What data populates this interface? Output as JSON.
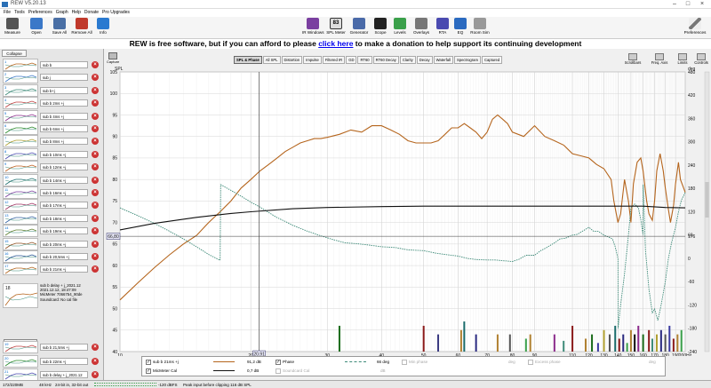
{
  "window": {
    "title": "REW V5.20.13"
  },
  "menu": [
    "File",
    "Tools",
    "Preferences",
    "Graph",
    "Help",
    "Donate",
    "Pro Upgrades"
  ],
  "toolbar_left": [
    {
      "label": "Measure",
      "icon": "microphone-icon",
      "color": "#555"
    },
    {
      "label": "Open",
      "icon": "folder-icon",
      "color": "#3a78c8"
    },
    {
      "label": "Save All",
      "icon": "save-icon",
      "color": "#4a6fa5"
    },
    {
      "label": "Remove All",
      "icon": "remove-icon",
      "color": "#c0392b"
    },
    {
      "label": "Info",
      "icon": "info-icon",
      "color": "#2a7ad0"
    }
  ],
  "toolbar_right": [
    {
      "label": "IR Windows",
      "icon": "ir-windows-icon",
      "color": "#7a3fa0"
    },
    {
      "label": "SPL Meter",
      "icon": "spl-meter-icon",
      "color": "#333"
    },
    {
      "label": "Generator",
      "icon": "generator-icon",
      "color": "#4a6aa8"
    },
    {
      "label": "Scope",
      "icon": "scope-icon",
      "color": "#222"
    },
    {
      "label": "Levels",
      "icon": "levels-icon",
      "color": "#3aa04a"
    },
    {
      "label": "Overlays",
      "icon": "overlays-icon",
      "color": "#777"
    },
    {
      "label": "RTA",
      "icon": "rta-icon",
      "color": "#4a4ab0"
    },
    {
      "label": "EQ",
      "icon": "eq-icon",
      "color": "#2a6ac0"
    },
    {
      "label": "Room Sim",
      "icon": "room-sim-icon",
      "color": "#999"
    }
  ],
  "spl_meter_value": "83",
  "preferences_label": "Preferences",
  "banner": {
    "prefix": "REW is free software, but if you can afford to please ",
    "link": "click here",
    "suffix": " to make a donation to help support its continuing development"
  },
  "left_panel": {
    "collapse_label": "Collapse",
    "measurements": [
      {
        "num": "1",
        "name": "sub b"
      },
      {
        "num": "2",
        "name": "sub j"
      },
      {
        "num": "3",
        "name": "sub b+j"
      },
      {
        "num": "4",
        "name": "sub b 2ms +j"
      },
      {
        "num": "5",
        "name": "sub b 4ms +j"
      },
      {
        "num": "6",
        "name": "sub b 6ms +j"
      },
      {
        "num": "7",
        "name": "sub b 8ms +j"
      },
      {
        "num": "8",
        "name": "sub b 10ms +j"
      },
      {
        "num": "9",
        "name": "sub b 12ms +j"
      },
      {
        "num": "10",
        "name": "sub b 14ms +j"
      },
      {
        "num": "11",
        "name": "sub b 16ms +j"
      },
      {
        "num": "12",
        "name": "sub b 17ms +j"
      },
      {
        "num": "13",
        "name": "sub b 18ms +j"
      },
      {
        "num": "14",
        "name": "sub b 19ms +j"
      },
      {
        "num": "15",
        "name": "sub b 20ms +j"
      },
      {
        "num": "16",
        "name": "sub b 20,5ms +j"
      },
      {
        "num": "17",
        "name": "sub b 21ms +j"
      }
    ],
    "selected": {
      "num": "18",
      "name": "sub b delay + j_2021.12",
      "date": "2021.12.12, 18:47:09",
      "mic": "MicMeter 7066754_90de",
      "soundcard": "Soundcard: No cal file"
    },
    "change_cal": "Change Cal",
    "after": [
      {
        "num": "19",
        "name": "sub b 21,5ms +j"
      },
      {
        "num": "20",
        "name": "sub b 22ms +j"
      },
      {
        "num": "21",
        "name": "sub b delay + j_2021.12",
        "date": "2021.12.12, 18:40:01"
      }
    ]
  },
  "capture_label": "Capture",
  "tabs": [
    "SPL & Phase",
    "All SPL",
    "Distortion",
    "Impulse",
    "Filtered IR",
    "GD",
    "RT60",
    "RT60 Decay",
    "Clarity",
    "Decay",
    "Waterfall",
    "Spectrogram",
    "Captured"
  ],
  "active_tab": "SPL & Phase",
  "right_tools": [
    {
      "label": "Scrollbars",
      "icon": "scrollbars-icon"
    },
    {
      "label": "Freq. Axis",
      "icon": "freq-axis-icon"
    },
    {
      "label": "Limits",
      "icon": "limits-icon"
    },
    {
      "label": "Controls",
      "icon": "controls-icon"
    }
  ],
  "chart_data": {
    "type": "line",
    "x_scale": "log",
    "xlim": [
      10,
      200
    ],
    "ylim": [
      40,
      105
    ],
    "y2lim": [
      -240,
      480
    ],
    "ylabel": "SPL",
    "y2label": "deg",
    "x_ticks": [
      "10",
      "20",
      "30",
      "40",
      "50",
      "60",
      "70",
      "80",
      "90",
      "110",
      "120",
      "130",
      "140",
      "150",
      "160",
      "170",
      "180",
      "190",
      "200Hz"
    ],
    "x_tick_values": [
      10,
      20,
      30,
      40,
      50,
      60,
      70,
      80,
      90,
      110,
      120,
      130,
      140,
      150,
      160,
      170,
      180,
      190,
      200
    ],
    "y_ticks": [
      40,
      45,
      50,
      55,
      60,
      65,
      70,
      75,
      80,
      85,
      90,
      95,
      100,
      105
    ],
    "y2_ticks": [
      -240,
      -180,
      -120,
      -60,
      0,
      60,
      120,
      180,
      240,
      300,
      360,
      420,
      480
    ],
    "cursor": {
      "x_label": "20,91",
      "y_label": "66,80",
      "y2_label": "176"
    },
    "series": [
      {
        "name": "sub b 21ms +j",
        "axis": "left",
        "color": "#b5651d",
        "x": [
          10,
          11,
          12,
          13,
          14,
          15,
          16,
          17,
          18,
          19,
          20,
          21,
          22,
          23,
          24,
          25,
          26,
          27,
          28,
          29,
          30,
          32,
          34,
          36,
          38,
          40,
          42,
          44,
          46,
          48,
          50,
          52,
          54,
          56,
          58,
          60,
          62,
          64,
          66,
          68,
          70,
          72,
          74,
          76,
          78,
          80,
          85,
          90,
          95,
          100,
          105,
          110,
          115,
          120,
          125,
          130,
          135,
          137,
          140,
          142,
          145,
          148,
          150,
          152,
          155,
          158,
          160,
          163,
          165,
          168,
          170,
          172,
          175,
          178,
          180,
          183,
          185,
          188,
          190,
          193,
          195,
          200
        ],
        "y": [
          52,
          56,
          59.5,
          62.5,
          65,
          67,
          70,
          72.5,
          75,
          78,
          80,
          82,
          83.5,
          85,
          86.5,
          87.5,
          88.5,
          89,
          89.5,
          89.5,
          89.8,
          90.5,
          91.5,
          91,
          92.5,
          92.5,
          91.5,
          90.5,
          89,
          88.5,
          88.5,
          88.5,
          89,
          90.5,
          92,
          92,
          93,
          92,
          91,
          89.5,
          91,
          94,
          95,
          94,
          93,
          91,
          90,
          92.5,
          90,
          89,
          88,
          86,
          85.5,
          85,
          83.5,
          82.5,
          80,
          75,
          70,
          72,
          80,
          75,
          70,
          79,
          84,
          85,
          82,
          75,
          72,
          70.5,
          75,
          82,
          86,
          82,
          78,
          73,
          70,
          74,
          79,
          84,
          80,
          77
        ]
      },
      {
        "name": "Phase",
        "axis": "right",
        "color": "#3d8a78",
        "dash": true,
        "x": [
          10,
          11,
          12,
          13,
          14,
          15,
          16,
          17,
          17.05,
          18,
          19,
          20,
          21,
          22,
          23,
          24,
          25,
          27,
          29,
          31,
          33,
          35,
          37,
          40,
          43,
          46,
          50,
          53,
          56,
          60,
          63,
          66,
          70,
          73,
          76,
          80,
          83,
          86,
          90,
          93,
          96,
          100,
          103,
          106,
          110,
          113,
          116,
          120,
          123,
          126,
          130,
          133,
          136,
          138,
          140,
          140.05,
          142,
          145,
          148,
          150,
          153,
          156,
          158,
          160,
          160.05,
          162,
          165,
          168,
          170,
          173,
          176,
          180,
          183,
          186,
          190,
          193,
          196,
          200
        ],
        "y": [
          130,
          110,
          90,
          70,
          50,
          30,
          10,
          -5,
          190,
          175,
          160,
          145,
          132,
          118,
          105,
          95,
          85,
          70,
          58,
          48,
          40,
          38,
          35,
          30,
          28,
          22,
          20,
          14,
          10,
          6,
          0,
          -3,
          -4,
          -4,
          -6,
          -8,
          -2,
          8,
          8,
          20,
          28,
          40,
          50,
          52,
          60,
          62,
          70,
          80,
          70,
          70,
          60,
          55,
          50,
          30,
          0,
          -180,
          -120,
          -40,
          60,
          130,
          140,
          130,
          100,
          60,
          190,
          20,
          -80,
          -140,
          -130,
          -160,
          -120,
          -60,
          0,
          40,
          80,
          120,
          150,
          170
        ]
      },
      {
        "name": "MicMeter Cal",
        "axis": "left",
        "color": "#111",
        "x": [
          10,
          12,
          15,
          18,
          20,
          25,
          30,
          40,
          50,
          60,
          70,
          80,
          90,
          100,
          120,
          140,
          160,
          180,
          200
        ],
        "y": [
          68.3,
          69.8,
          71.2,
          72.1,
          72.5,
          73.2,
          73.5,
          73.7,
          73.8,
          73.8,
          73.8,
          73.8,
          73.8,
          73.8,
          73.8,
          73.8,
          73.8,
          73.5,
          73.4
        ]
      }
    ],
    "bars": [
      {
        "x": 32,
        "y": 46,
        "color": "#1a6b1a"
      },
      {
        "x": 50,
        "y": 46,
        "color": "#8b1a1a"
      },
      {
        "x": 54,
        "y": 44,
        "color": "#3a3a80"
      },
      {
        "x": 61,
        "y": 45,
        "color": "#b08030"
      },
      {
        "x": 62,
        "y": 47,
        "color": "#1a6b6b"
      },
      {
        "x": 66,
        "y": 44,
        "color": "#2a2a80"
      },
      {
        "x": 74,
        "y": 44,
        "color": "#b08030"
      },
      {
        "x": 79,
        "y": 44,
        "color": "#555"
      },
      {
        "x": 86,
        "y": 43,
        "color": "#3aa04a"
      },
      {
        "x": 88,
        "y": 44,
        "color": "#b08030"
      },
      {
        "x": 100,
        "y": 44,
        "color": "#8b2a8b"
      },
      {
        "x": 105,
        "y": 42.5,
        "color": "#3d8a78"
      },
      {
        "x": 110,
        "y": 46,
        "color": "#8b1a1a"
      },
      {
        "x": 118,
        "y": 43,
        "color": "#b08030"
      },
      {
        "x": 122,
        "y": 44,
        "color": "#1a6b1a"
      },
      {
        "x": 126,
        "y": 42,
        "color": "#3a3aa0"
      },
      {
        "x": 130,
        "y": 45,
        "color": "#b0a030"
      },
      {
        "x": 134,
        "y": 44,
        "color": "#555"
      },
      {
        "x": 138,
        "y": 46,
        "color": "#1a6b6b"
      },
      {
        "x": 141,
        "y": 43,
        "color": "#8b1a1a"
      },
      {
        "x": 144,
        "y": 44,
        "color": "#2a2a80"
      },
      {
        "x": 147,
        "y": 42,
        "color": "#3aa04a"
      },
      {
        "x": 150,
        "y": 45,
        "color": "#b08030"
      },
      {
        "x": 153,
        "y": 44,
        "color": "#111"
      },
      {
        "x": 156,
        "y": 46,
        "color": "#8b2a8b"
      },
      {
        "x": 160,
        "y": 44,
        "color": "#1a6b1a"
      },
      {
        "x": 165,
        "y": 45,
        "color": "#8b1a1a"
      },
      {
        "x": 168,
        "y": 43,
        "color": "#3d8a78"
      },
      {
        "x": 172,
        "y": 44,
        "color": "#b0a030"
      },
      {
        "x": 176,
        "y": 45,
        "color": "#2a2a80"
      },
      {
        "x": 180,
        "y": 44,
        "color": "#555"
      },
      {
        "x": 184,
        "y": 46,
        "color": "#3a3aa0"
      },
      {
        "x": 188,
        "y": 43,
        "color": "#8b1a1a"
      },
      {
        "x": 192,
        "y": 44,
        "color": "#b08030"
      },
      {
        "x": 196,
        "y": 45,
        "color": "#3aa04a"
      }
    ]
  },
  "legend": {
    "row1": {
      "name": "sub b 21ms +j",
      "value": "91,2 dB",
      "phase_label": "Phase",
      "phase_value": "66 deg",
      "min_phase": "Min phase",
      "min_phase_unit": "deg",
      "excess_phase": "Excess phase",
      "excess_phase_unit": "deg"
    },
    "row2": {
      "name": "MicMeter Cal",
      "value": "0,7 dB",
      "soundcard_cal": "Soundcard Cal",
      "soundcard_unit": "dB"
    }
  },
  "status": {
    "memory": "172/220MB",
    "sample_rate": "48 kHz",
    "format": "24-bit in, 32-bit out",
    "level": "-120 dBFS",
    "clip": "Peak input before clipping 116 dB SPL"
  }
}
